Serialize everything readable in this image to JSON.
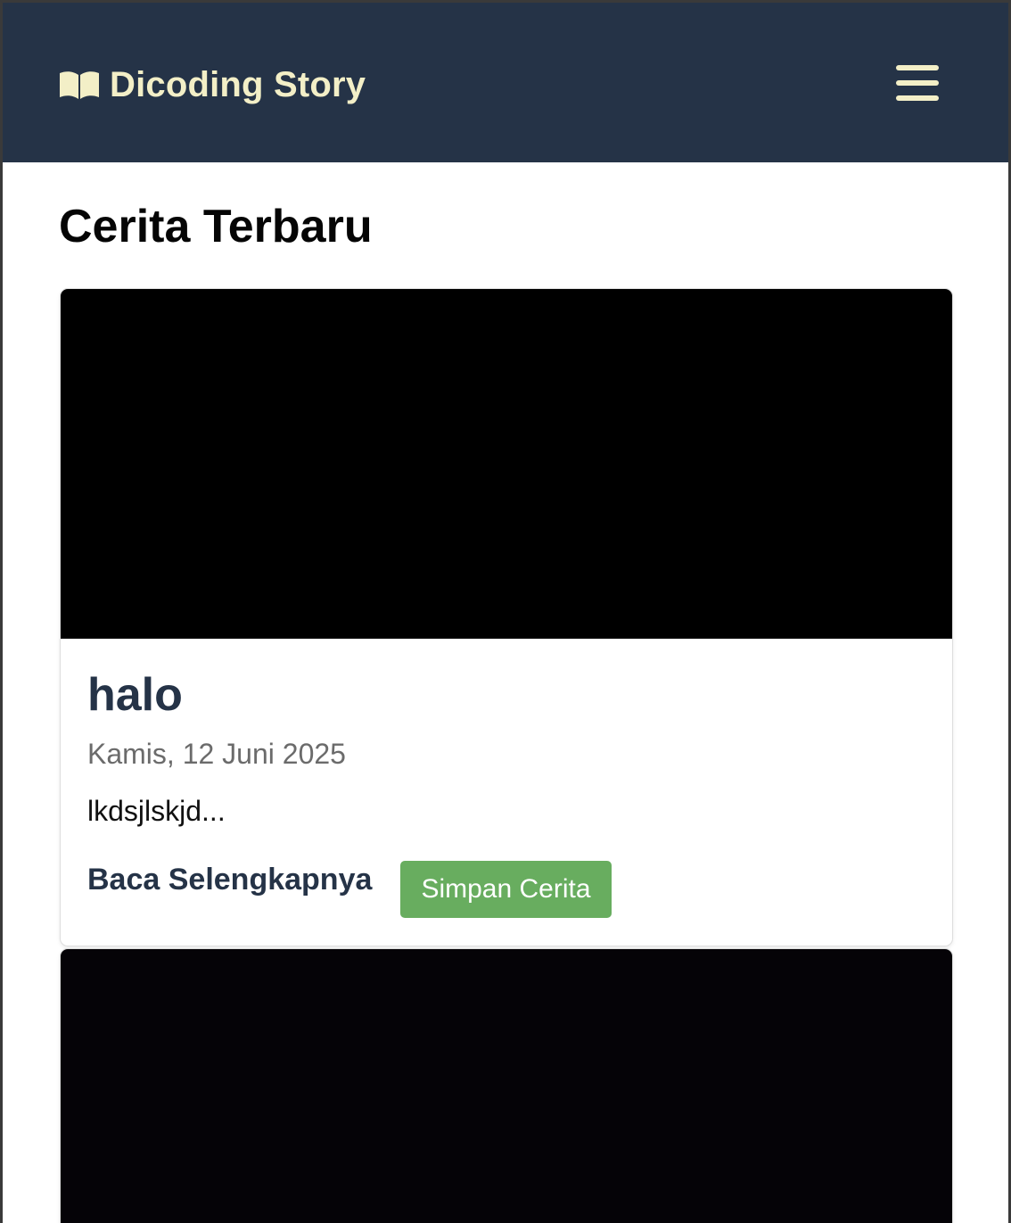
{
  "header": {
    "brand": "Dicoding Story",
    "brand_icon": "open-book-icon",
    "menu_icon": "hamburger-menu-icon",
    "background": "#253347",
    "text_color": "#F3EFC7"
  },
  "main": {
    "title": "Cerita Terbaru",
    "stories": [
      {
        "title": "halo",
        "date": "Kamis, 12 Juni 2025",
        "description": "lkdsjlskjd...",
        "read_more": "Baca Selengkapnya",
        "save_label": "Simpan Cerita"
      },
      {
        "title": "",
        "date": "",
        "description": "",
        "read_more": "",
        "save_label": ""
      }
    ]
  },
  "colors": {
    "primary": "#253347",
    "save_button": "#68AD5F",
    "date_text": "#6B6B6B"
  }
}
